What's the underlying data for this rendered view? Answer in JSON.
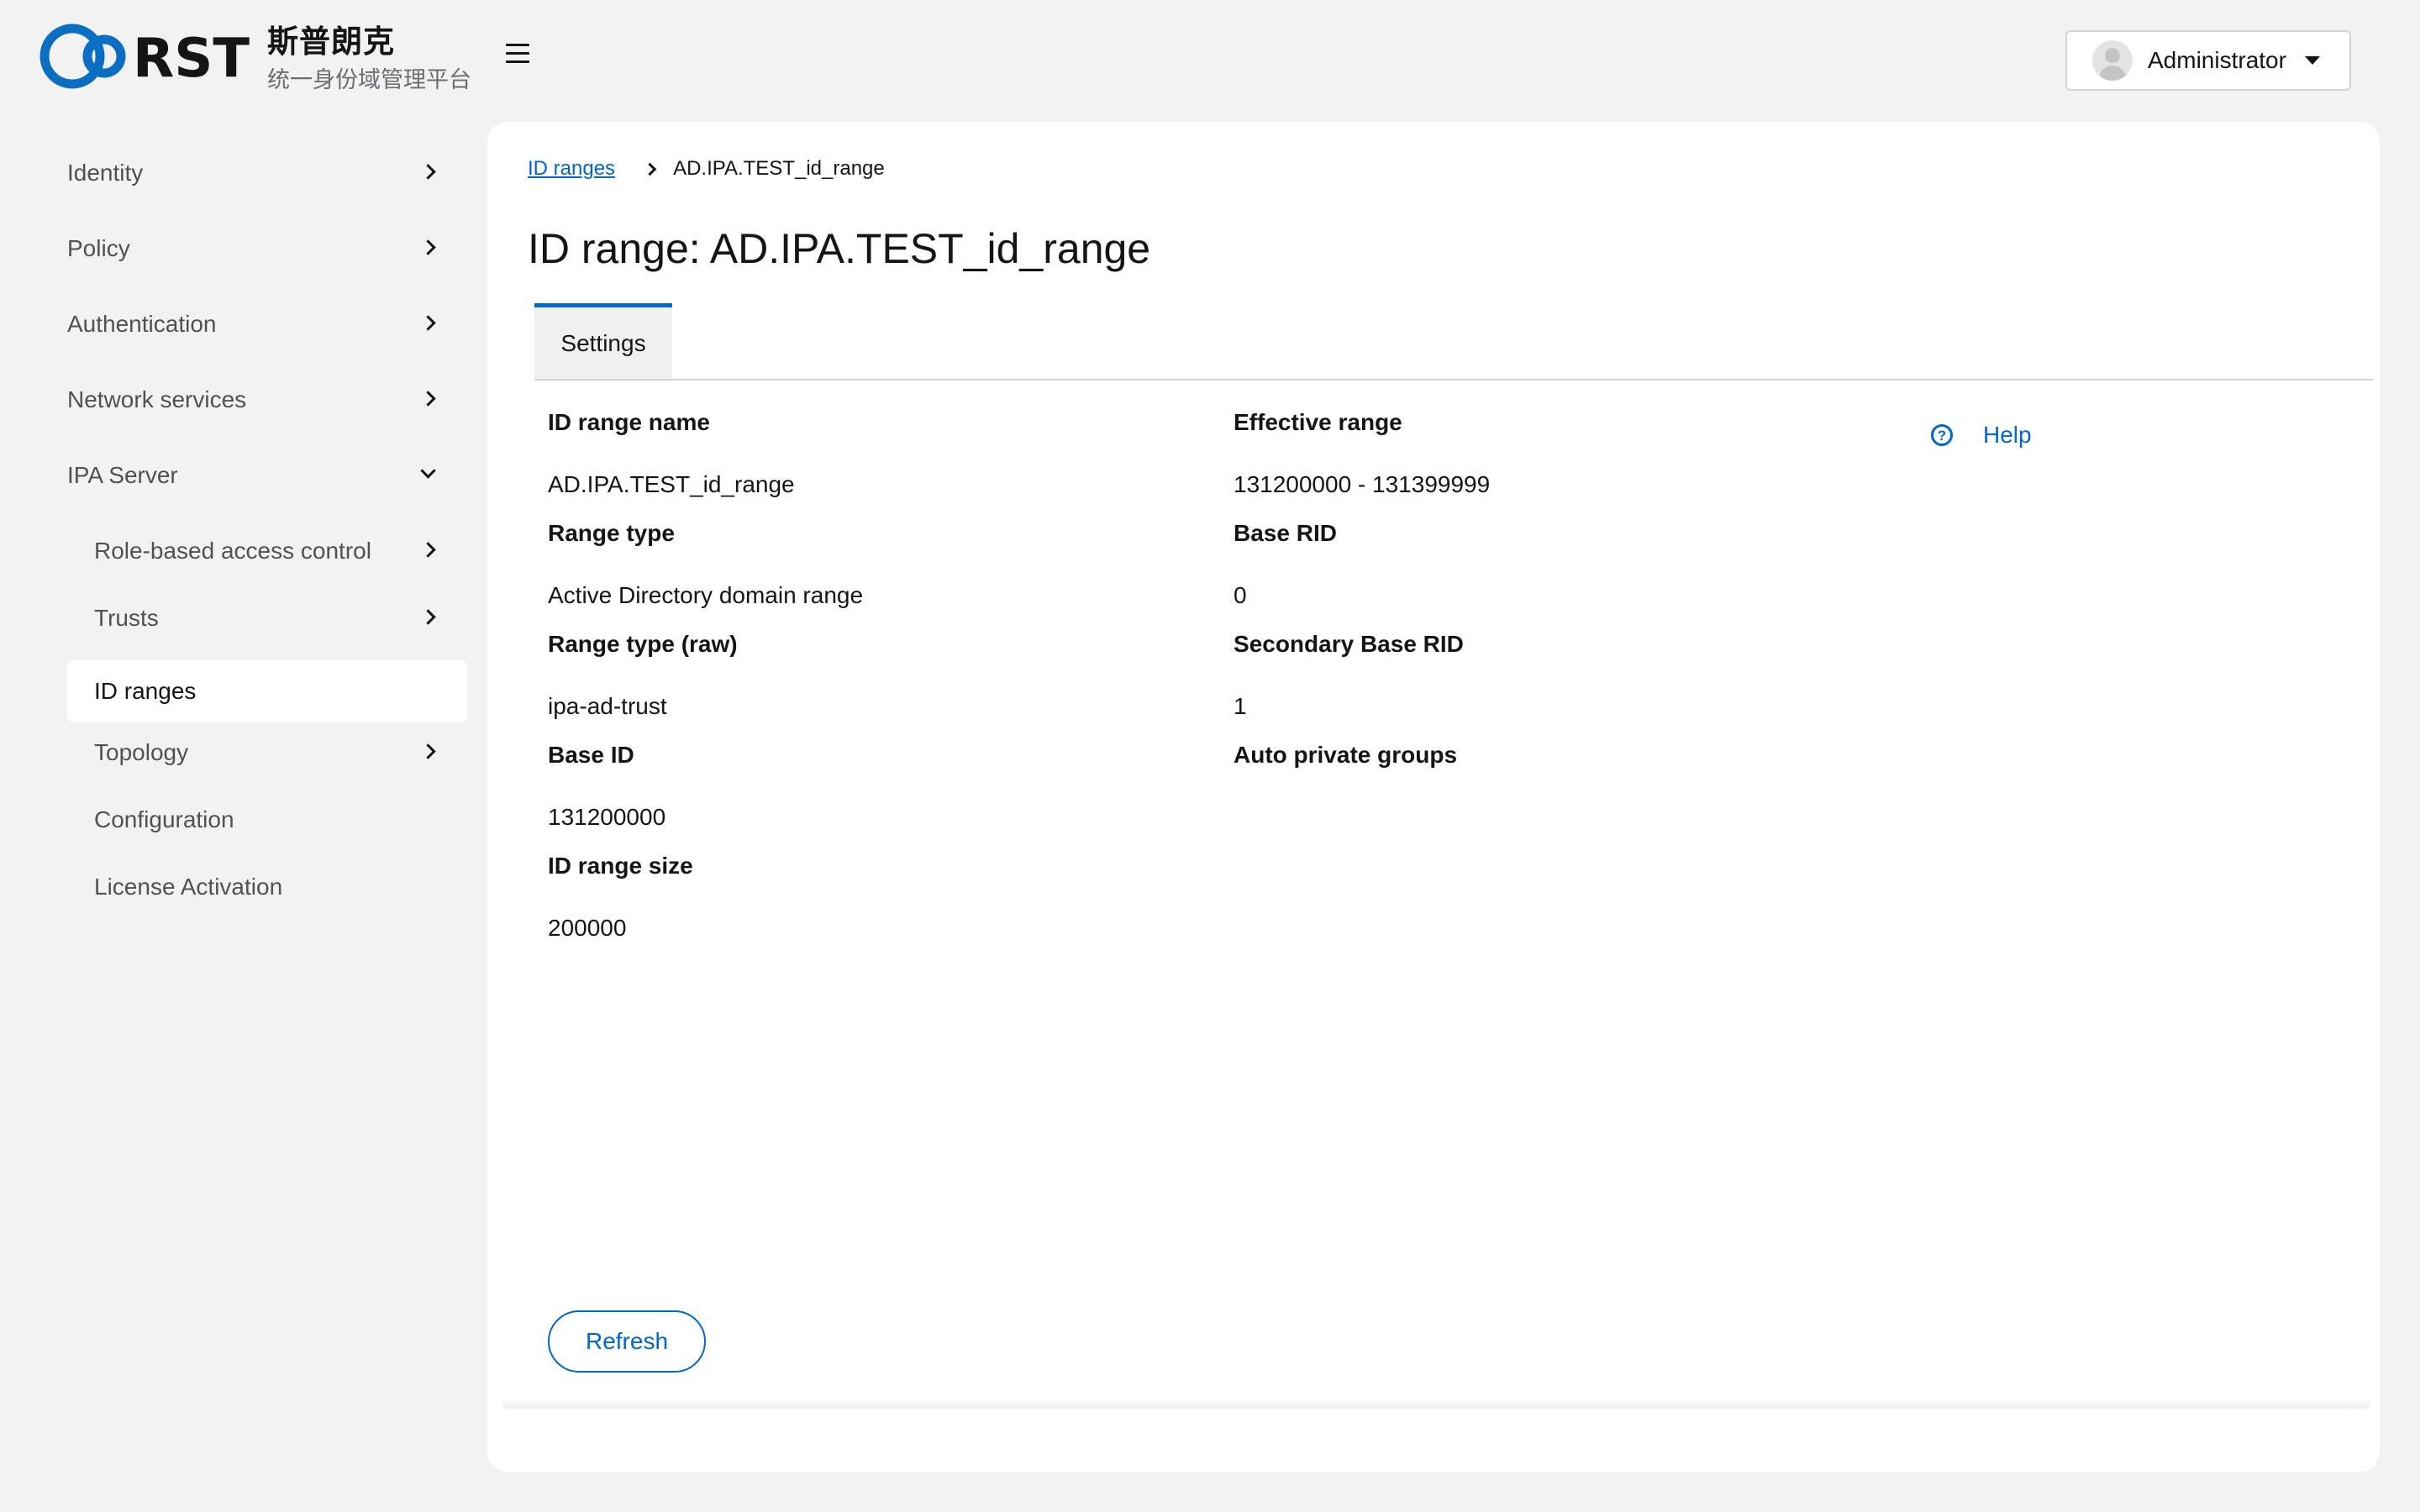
{
  "header": {
    "logo_text": "RST",
    "logo_cn_title": "斯普朗克",
    "logo_cn_subtitle": "统一身份域管理平台",
    "user_name": "Administrator"
  },
  "sidebar": {
    "items": [
      {
        "label": "Identity"
      },
      {
        "label": "Policy"
      },
      {
        "label": "Authentication"
      },
      {
        "label": "Network services"
      },
      {
        "label": "IPA Server"
      },
      {
        "label": "Role-based access control"
      },
      {
        "label": "Trusts"
      },
      {
        "label": "ID ranges"
      },
      {
        "label": "Topology"
      },
      {
        "label": "Configuration"
      },
      {
        "label": "License Activation"
      }
    ],
    "active": "ID ranges"
  },
  "main": {
    "breadcrumb": {
      "parent": "ID ranges",
      "current": "AD.IPA.TEST_id_range"
    },
    "title": "ID range: AD.IPA.TEST_id_range",
    "tabs": [
      {
        "label": "Settings"
      }
    ],
    "fields_left": [
      {
        "label": "ID range name",
        "value": "AD.IPA.TEST_id_range"
      },
      {
        "label": "Range type",
        "value": "Active Directory domain range"
      },
      {
        "label": "Range type (raw)",
        "value": "ipa-ad-trust"
      },
      {
        "label": "Base ID",
        "value": "131200000"
      },
      {
        "label": "ID range size",
        "value": "200000"
      }
    ],
    "fields_right": [
      {
        "label": "Effective range",
        "value": "131200000 - 131399999"
      },
      {
        "label": "Base RID",
        "value": "0"
      },
      {
        "label": "Secondary Base RID",
        "value": "1"
      },
      {
        "label": "Auto private groups",
        "value": ""
      }
    ],
    "help_label": "Help",
    "help_icon_glyph": "?",
    "refresh_label": "Refresh"
  },
  "colors": {
    "accent": "#0066cc",
    "page_bg": "#f2f2f2",
    "panel_bg": "#ffffff"
  }
}
